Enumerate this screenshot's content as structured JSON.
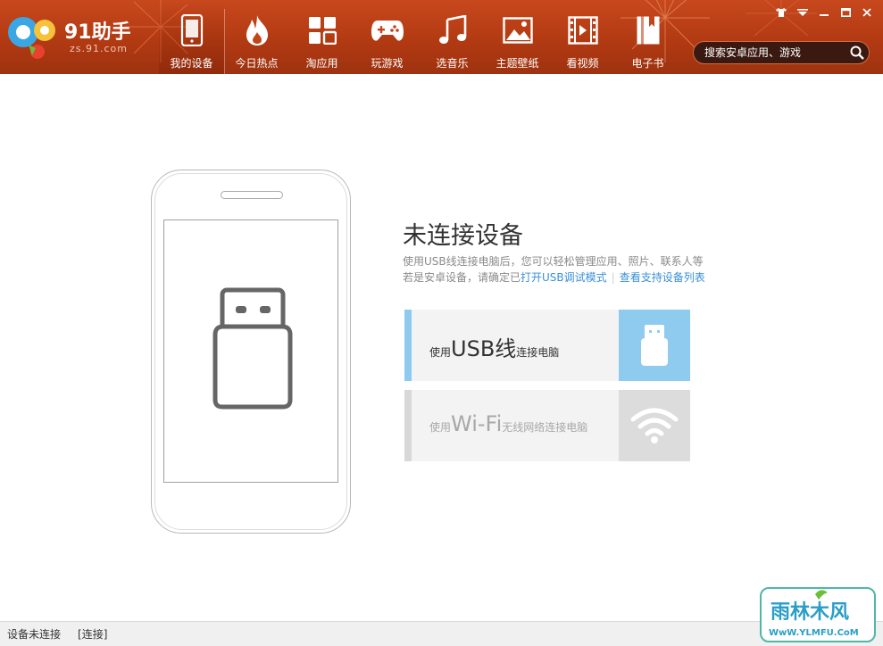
{
  "app": {
    "logo_title": "91助手",
    "logo_sub": "zs.91.com"
  },
  "nav": [
    {
      "label": "我的设备",
      "icon": "phone-icon",
      "active": true
    },
    {
      "label": "今日热点",
      "icon": "flame-icon",
      "active": false
    },
    {
      "label": "淘应用",
      "icon": "apps-grid-icon",
      "active": false
    },
    {
      "label": "玩游戏",
      "icon": "gamepad-icon",
      "active": false
    },
    {
      "label": "选音乐",
      "icon": "music-note-icon",
      "active": false
    },
    {
      "label": "主题壁纸",
      "icon": "picture-icon",
      "active": false
    },
    {
      "label": "看视频",
      "icon": "film-icon",
      "active": false
    },
    {
      "label": "电子书",
      "icon": "book-icon",
      "active": false
    }
  ],
  "window_controls": [
    "skin-icon",
    "menu-icon",
    "minimize-icon",
    "maximize-icon",
    "close-icon"
  ],
  "search": {
    "placeholder": "搜索安卓应用、游戏"
  },
  "main": {
    "title": "未连接设备",
    "desc_line1": "使用USB线连接电脑后，您可以轻松管理应用、照片、联系人等",
    "desc_line2_prefix": "若是安卓设备，请确定已",
    "link_usb_debug": "打开USB调试模式",
    "link_device_list": "查看支持设备列表",
    "options": {
      "usb": {
        "pre": "使用",
        "big": "USB线",
        "post": "连接电脑"
      },
      "wifi": {
        "pre": "使用",
        "big": "Wi-Fi",
        "post": "无线网络连接电脑"
      }
    }
  },
  "status": {
    "state": "设备未连接",
    "connect_label": "[连接]"
  },
  "watermark": {
    "name": "雨林木风",
    "url": "WwW.YLMFU.CoM"
  },
  "colors": {
    "header": "#b23a12",
    "usb_accent": "#8ecbef",
    "link": "#3a8fd8",
    "watermark_border": "#4fb7a8"
  }
}
